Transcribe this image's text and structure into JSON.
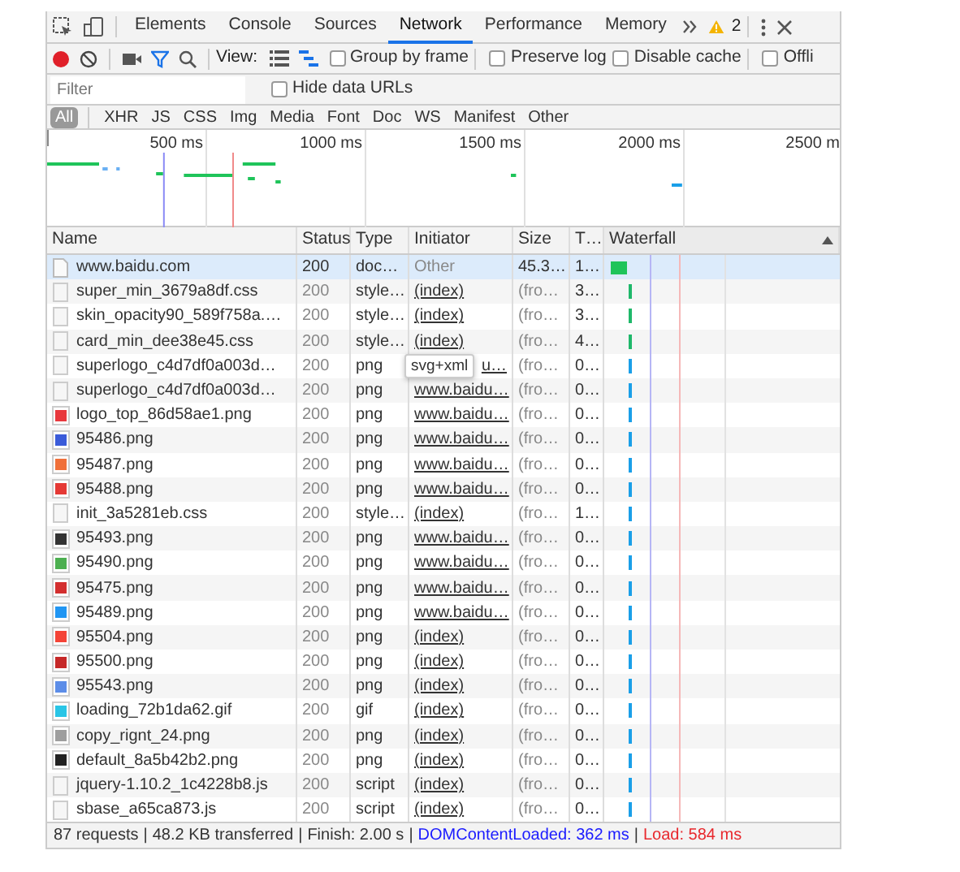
{
  "tabs": [
    {
      "label": "Elements",
      "selected": false
    },
    {
      "label": "Console",
      "selected": false
    },
    {
      "label": "Sources",
      "selected": false
    },
    {
      "label": "Network",
      "selected": true
    },
    {
      "label": "Performance",
      "selected": false
    },
    {
      "label": "Memory",
      "selected": false
    }
  ],
  "warnings": {
    "count": "2"
  },
  "toolbar": {
    "recording": true,
    "filter_active": true,
    "view_label": "View:",
    "views": [
      {
        "kind": "list",
        "selected": false
      },
      {
        "kind": "waterfall",
        "selected": true
      }
    ],
    "checkboxes": [
      {
        "label": "Group by frame",
        "checked": false
      },
      {
        "label": "Preserve log",
        "checked": false
      },
      {
        "label": "Disable cache",
        "checked": false
      },
      {
        "label": "Offli",
        "checked": false
      }
    ]
  },
  "filter": {
    "placeholder": "Filter"
  },
  "hide_data_urls": {
    "label": "Hide data URLs",
    "checked": false
  },
  "type_filters": [
    {
      "label": "All",
      "selected": true
    },
    {
      "label": "XHR",
      "selected": false
    },
    {
      "label": "JS",
      "selected": false
    },
    {
      "label": "CSS",
      "selected": false
    },
    {
      "label": "Img",
      "selected": false
    },
    {
      "label": "Media",
      "selected": false
    },
    {
      "label": "Font",
      "selected": false
    },
    {
      "label": "Doc",
      "selected": false
    },
    {
      "label": "WS",
      "selected": false
    },
    {
      "label": "Manifest",
      "selected": false
    },
    {
      "label": "Other",
      "selected": false
    }
  ],
  "overview": {
    "ticks": [
      "500 ms",
      "1000 ms",
      "1500 ms",
      "2000 ms",
      "2500 m"
    ]
  },
  "table": {
    "columns": [
      {
        "label": "Name"
      },
      {
        "label": "Status"
      },
      {
        "label": "Type"
      },
      {
        "label": "Initiator"
      },
      {
        "label": "Size"
      },
      {
        "label": "T…"
      },
      {
        "label": "Waterfall",
        "sorted": true
      }
    ],
    "rows": [
      {
        "name": "www.baidu.com",
        "status": "200",
        "type": "doc…",
        "initiator": "Other",
        "initiator_link": false,
        "size": "45.3…",
        "time": "1…",
        "selected": true,
        "cached": false,
        "icon": {
          "kind": "document"
        },
        "bar": {
          "kind": "block",
          "color": "#1fc45a"
        }
      },
      {
        "name": "super_min_3679a8df.css",
        "status": "200",
        "type": "style…",
        "initiator": "(index)",
        "initiator_link": true,
        "size": "(fro…",
        "time": "3…",
        "selected": false,
        "cached": true,
        "icon": {
          "kind": "file"
        },
        "bar": {
          "kind": "tick",
          "color": "#1fb86a"
        }
      },
      {
        "name": "skin_opacity90_589f758a.…",
        "status": "200",
        "type": "style…",
        "initiator": "(index)",
        "initiator_link": true,
        "size": "(fro…",
        "time": "3…",
        "selected": false,
        "cached": true,
        "icon": {
          "kind": "file"
        },
        "bar": {
          "kind": "tick",
          "color": "#1fb86a"
        }
      },
      {
        "name": "card_min_dee38e45.css",
        "status": "200",
        "type": "style…",
        "initiator": "(index)",
        "initiator_link": true,
        "size": "(fro…",
        "time": "4…",
        "selected": false,
        "cached": true,
        "icon": {
          "kind": "file"
        },
        "bar": {
          "kind": "tick",
          "color": "#1fb86a"
        }
      },
      {
        "name": "superlogo_c4d7df0a003d…",
        "status": "200",
        "type": "png",
        "initiator": "u…",
        "initiator_link": true,
        "size": "(fro…",
        "time": "0…",
        "selected": false,
        "cached": true,
        "icon": {
          "kind": "file"
        },
        "bar": {
          "kind": "tick",
          "color": "#1a9fe8"
        }
      },
      {
        "name": "superlogo_c4d7df0a003d…",
        "status": "200",
        "type": "png",
        "initiator": "www.baidu…",
        "initiator_link": true,
        "size": "(fro…",
        "time": "0…",
        "selected": false,
        "cached": true,
        "icon": {
          "kind": "file"
        },
        "bar": {
          "kind": "tick",
          "color": "#1a9fe8"
        }
      },
      {
        "name": "logo_top_86d58ae1.png",
        "status": "200",
        "type": "png",
        "initiator": "www.baidu…",
        "initiator_link": true,
        "size": "(fro…",
        "time": "0…",
        "selected": false,
        "cached": true,
        "icon": {
          "kind": "image",
          "color": "#e8383d"
        },
        "bar": {
          "kind": "tick",
          "color": "#1a9fe8"
        }
      },
      {
        "name": "95486.png",
        "status": "200",
        "type": "png",
        "initiator": "www.baidu…",
        "initiator_link": true,
        "size": "(fro…",
        "time": "0…",
        "selected": false,
        "cached": true,
        "icon": {
          "kind": "image",
          "color": "#3a5bd9"
        },
        "bar": {
          "kind": "tick",
          "color": "#1a9fe8"
        }
      },
      {
        "name": "95487.png",
        "status": "200",
        "type": "png",
        "initiator": "www.baidu…",
        "initiator_link": true,
        "size": "(fro…",
        "time": "0…",
        "selected": false,
        "cached": true,
        "icon": {
          "kind": "image",
          "color": "#f0703a"
        },
        "bar": {
          "kind": "tick",
          "color": "#1a9fe8"
        }
      },
      {
        "name": "95488.png",
        "status": "200",
        "type": "png",
        "initiator": "www.baidu…",
        "initiator_link": true,
        "size": "(fro…",
        "time": "0…",
        "selected": false,
        "cached": true,
        "icon": {
          "kind": "image",
          "color": "#e53935"
        },
        "bar": {
          "kind": "tick",
          "color": "#1a9fe8"
        }
      },
      {
        "name": "init_3a5281eb.css",
        "status": "200",
        "type": "style…",
        "initiator": "(index)",
        "initiator_link": true,
        "size": "(fro…",
        "time": "1…",
        "selected": false,
        "cached": true,
        "icon": {
          "kind": "file"
        },
        "bar": {
          "kind": "tick",
          "color": "#1a9fe8"
        }
      },
      {
        "name": "95493.png",
        "status": "200",
        "type": "png",
        "initiator": "www.baidu…",
        "initiator_link": true,
        "size": "(fro…",
        "time": "0…",
        "selected": false,
        "cached": true,
        "icon": {
          "kind": "image",
          "color": "#333333"
        },
        "bar": {
          "kind": "tick",
          "color": "#1a9fe8"
        }
      },
      {
        "name": "95490.png",
        "status": "200",
        "type": "png",
        "initiator": "www.baidu…",
        "initiator_link": true,
        "size": "(fro…",
        "time": "0…",
        "selected": false,
        "cached": true,
        "icon": {
          "kind": "image",
          "color": "#4caf50"
        },
        "bar": {
          "kind": "tick",
          "color": "#1a9fe8"
        }
      },
      {
        "name": "95475.png",
        "status": "200",
        "type": "png",
        "initiator": "www.baidu…",
        "initiator_link": true,
        "size": "(fro…",
        "time": "0…",
        "selected": false,
        "cached": true,
        "icon": {
          "kind": "image",
          "color": "#d32f2f"
        },
        "bar": {
          "kind": "tick",
          "color": "#1a9fe8"
        }
      },
      {
        "name": "95489.png",
        "status": "200",
        "type": "png",
        "initiator": "www.baidu…",
        "initiator_link": true,
        "size": "(fro…",
        "time": "0…",
        "selected": false,
        "cached": true,
        "icon": {
          "kind": "image",
          "color": "#2196f3"
        },
        "bar": {
          "kind": "tick",
          "color": "#1a9fe8"
        }
      },
      {
        "name": "95504.png",
        "status": "200",
        "type": "png",
        "initiator": "(index)",
        "initiator_link": true,
        "size": "(fro…",
        "time": "0…",
        "selected": false,
        "cached": true,
        "icon": {
          "kind": "image",
          "color": "#f44336"
        },
        "bar": {
          "kind": "tick",
          "color": "#1a9fe8"
        }
      },
      {
        "name": "95500.png",
        "status": "200",
        "type": "png",
        "initiator": "(index)",
        "initiator_link": true,
        "size": "(fro…",
        "time": "0…",
        "selected": false,
        "cached": true,
        "icon": {
          "kind": "image",
          "color": "#c62828"
        },
        "bar": {
          "kind": "tick",
          "color": "#1a9fe8"
        }
      },
      {
        "name": "95543.png",
        "status": "200",
        "type": "png",
        "initiator": "(index)",
        "initiator_link": true,
        "size": "(fro…",
        "time": "0…",
        "selected": false,
        "cached": true,
        "icon": {
          "kind": "image",
          "color": "#5c8de8"
        },
        "bar": {
          "kind": "tick",
          "color": "#1a9fe8"
        }
      },
      {
        "name": "loading_72b1da62.gif",
        "status": "200",
        "type": "gif",
        "initiator": "(index)",
        "initiator_link": true,
        "size": "(fro…",
        "time": "0…",
        "selected": false,
        "cached": true,
        "icon": {
          "kind": "image",
          "color": "#29c5e6"
        },
        "bar": {
          "kind": "tick",
          "color": "#1a9fe8"
        }
      },
      {
        "name": "copy_rignt_24.png",
        "status": "200",
        "type": "png",
        "initiator": "(index)",
        "initiator_link": true,
        "size": "(fro…",
        "time": "0…",
        "selected": false,
        "cached": true,
        "icon": {
          "kind": "image",
          "color": "#9e9e9e"
        },
        "bar": {
          "kind": "tick",
          "color": "#1a9fe8"
        }
      },
      {
        "name": "default_8a5b42b2.png",
        "status": "200",
        "type": "png",
        "initiator": "(index)",
        "initiator_link": true,
        "size": "(fro…",
        "time": "0…",
        "selected": false,
        "cached": true,
        "icon": {
          "kind": "image",
          "color": "#222222"
        },
        "bar": {
          "kind": "tick",
          "color": "#1a9fe8"
        }
      },
      {
        "name": "jquery-1.10.2_1c4228b8.js",
        "status": "200",
        "type": "script",
        "initiator": "(index)",
        "initiator_link": true,
        "size": "(fro…",
        "time": "0…",
        "selected": false,
        "cached": true,
        "icon": {
          "kind": "file"
        },
        "bar": {
          "kind": "tick",
          "color": "#1a9fe8"
        }
      },
      {
        "name": "sbase_a65ca873.js",
        "status": "200",
        "type": "script",
        "initiator": "(index)",
        "initiator_link": true,
        "size": "(fro…",
        "time": "0…",
        "selected": false,
        "cached": true,
        "icon": {
          "kind": "file"
        },
        "bar": {
          "kind": "tick",
          "color": "#1a9fe8"
        }
      }
    ]
  },
  "tooltip": {
    "text": "svg+xml"
  },
  "status_bar": [
    {
      "kind": "plain",
      "text": "87 requests"
    },
    {
      "kind": "separator",
      "text": "|"
    },
    {
      "kind": "plain",
      "text": "48.2 KB transferred"
    },
    {
      "kind": "separator",
      "text": "|"
    },
    {
      "kind": "plain",
      "text": "Finish: 2.00 s"
    },
    {
      "kind": "separator",
      "text": "|"
    },
    {
      "kind": "dom",
      "text": "DOMContentLoaded: 362 ms"
    },
    {
      "kind": "separator",
      "text": "|"
    },
    {
      "kind": "load",
      "text": "Load: 584 ms"
    }
  ]
}
